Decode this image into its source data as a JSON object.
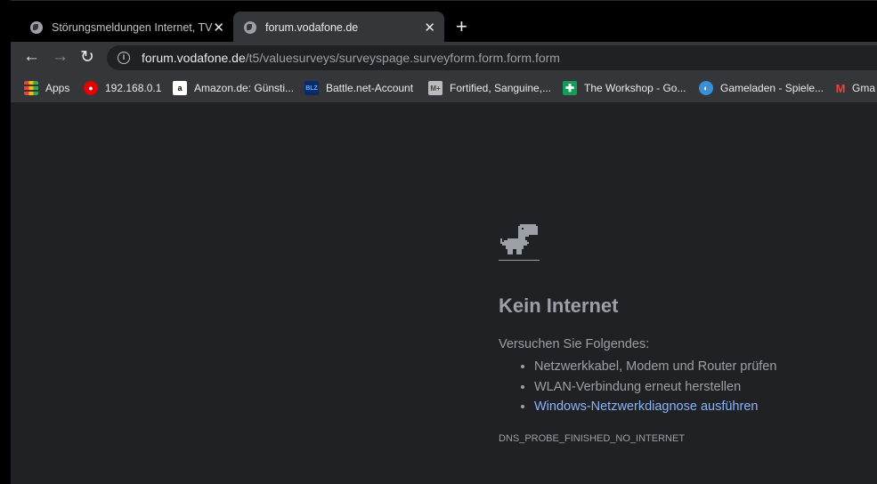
{
  "tabs": [
    {
      "title": "Störungsmeldungen Internet, TV",
      "active": false
    },
    {
      "title": "forum.vodafone.de",
      "active": true
    }
  ],
  "tab_close": "✕",
  "new_tab": "+",
  "toolbar": {
    "back": "←",
    "forward": "→",
    "reload": "↻",
    "url_host": "forum.vodafone.de",
    "url_path": "/t5/valuesurveys/surveyspage.surveyform.form.form.form"
  },
  "bookmarks": [
    {
      "label": "Apps",
      "icon": "apps-grid-icon"
    },
    {
      "label": "192.168.0.1",
      "icon": "vodafone-icon"
    },
    {
      "label": "Amazon.de: Günsti...",
      "icon": "amazon-icon"
    },
    {
      "label": "Battle.net-Account",
      "icon": "blizzard-icon"
    },
    {
      "label": "Fortified, Sanguine,...",
      "icon": "mplus-icon"
    },
    {
      "label": "The Workshop - Go...",
      "icon": "workshop-icon"
    },
    {
      "label": "Gameladen - Spiele...",
      "icon": "gameladen-icon"
    },
    {
      "label": "Gma",
      "icon": "gmail-icon"
    }
  ],
  "error": {
    "title": "Kein Internet",
    "try_label": "Versuchen Sie Folgendes:",
    "suggestions": [
      "Netzwerkkabel, Modem und Router prüfen",
      "WLAN-Verbindung erneut herstellen"
    ],
    "diagnose_link": "Windows-Netzwerkdiagnose ausführen",
    "code": "DNS_PROBE_FINISHED_NO_INTERNET"
  }
}
